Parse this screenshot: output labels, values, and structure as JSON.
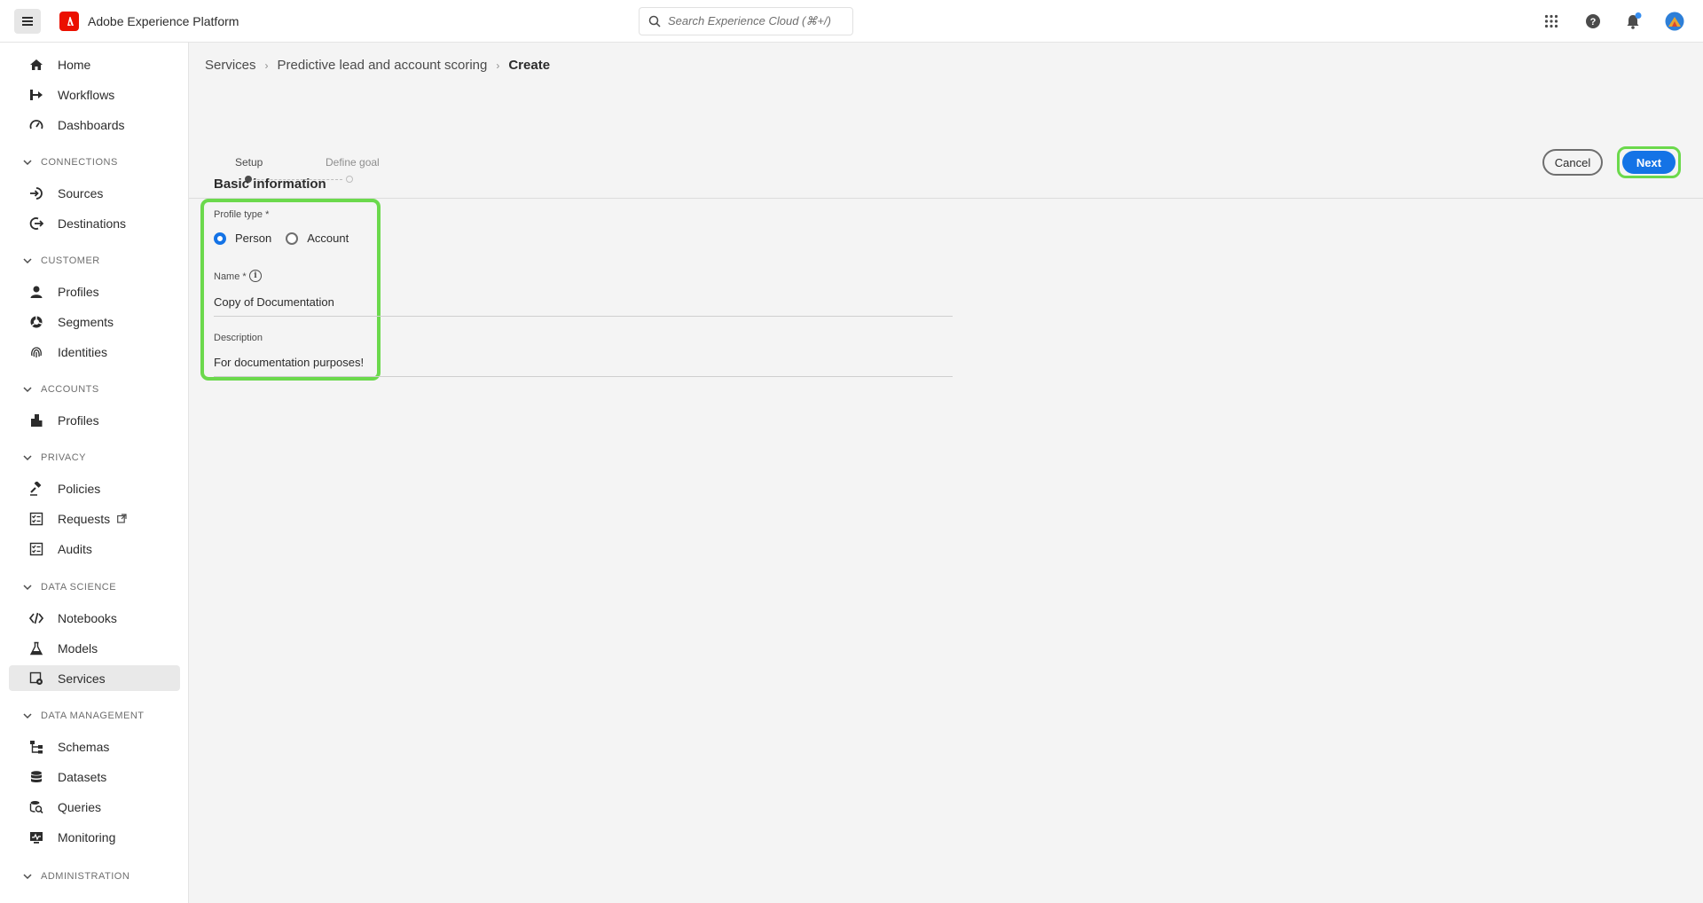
{
  "app": {
    "title": "Adobe Experience Platform"
  },
  "search": {
    "placeholder": "Search Experience Cloud (⌘+/)"
  },
  "sidebar": {
    "items": [
      {
        "label": "Home",
        "icon": "home-icon"
      },
      {
        "label": "Workflows",
        "icon": "workflow-icon"
      },
      {
        "label": "Dashboards",
        "icon": "dashboard-icon"
      }
    ],
    "sections": [
      {
        "title": "CONNECTIONS",
        "items": [
          {
            "label": "Sources",
            "icon": "sources-icon"
          },
          {
            "label": "Destinations",
            "icon": "destinations-icon"
          }
        ]
      },
      {
        "title": "CUSTOMER",
        "items": [
          {
            "label": "Profiles",
            "icon": "person-icon"
          },
          {
            "label": "Segments",
            "icon": "segments-icon"
          },
          {
            "label": "Identities",
            "icon": "fingerprint-icon"
          }
        ]
      },
      {
        "title": "ACCOUNTS",
        "items": [
          {
            "label": "Profiles",
            "icon": "building-icon"
          }
        ]
      },
      {
        "title": "PRIVACY",
        "items": [
          {
            "label": "Policies",
            "icon": "gavel-icon"
          },
          {
            "label": "Requests",
            "icon": "checklist-icon"
          },
          {
            "label": "Audits",
            "icon": "checklist-icon"
          }
        ]
      },
      {
        "title": "DATA SCIENCE",
        "items": [
          {
            "label": "Notebooks",
            "icon": "code-icon"
          },
          {
            "label": "Models",
            "icon": "flask-icon"
          },
          {
            "label": "Services",
            "icon": "services-icon",
            "active": true
          }
        ]
      },
      {
        "title": "DATA MANAGEMENT",
        "items": [
          {
            "label": "Schemas",
            "icon": "schema-icon"
          },
          {
            "label": "Datasets",
            "icon": "database-icon"
          },
          {
            "label": "Queries",
            "icon": "query-icon"
          },
          {
            "label": "Monitoring",
            "icon": "monitor-icon"
          }
        ]
      },
      {
        "title": "ADMINISTRATION",
        "items": []
      }
    ]
  },
  "breadcrumb": {
    "items": [
      "Services",
      "Predictive lead and account scoring"
    ],
    "current": "Create"
  },
  "stepper": {
    "steps": [
      "Setup",
      "Define goal"
    ]
  },
  "actions": {
    "cancel": "Cancel",
    "next": "Next"
  },
  "form": {
    "section_title": "Basic information",
    "profile_type_label": "Profile type *",
    "profile_options": [
      "Person",
      "Account"
    ],
    "profile_selected": "Person",
    "name_label": "Name *",
    "name_value": "Copy of Documentation",
    "description_label": "Description",
    "description_value": "For documentation purposes!"
  },
  "colors": {
    "accent": "#1473e6",
    "highlight": "#6bd94c",
    "brand": "#eb1000"
  }
}
